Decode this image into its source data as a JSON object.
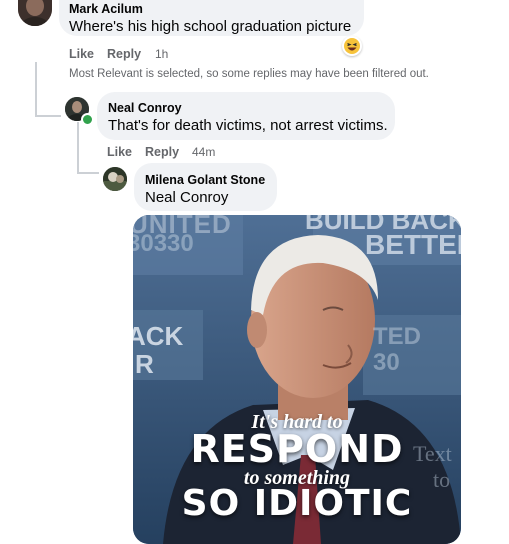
{
  "comments": [
    {
      "author": "Mark Acilum",
      "text": "Where's his high school graduation picture",
      "reaction_icon": "haha-emoji-icon",
      "like_label": "Like",
      "reply_label": "Reply",
      "time": "1h"
    },
    {
      "author": "Neal Conroy",
      "text": "That's for death victims, not arrest victims.",
      "online_status_color": "#31a24c",
      "like_label": "Like",
      "reply_label": "Reply",
      "time": "44m"
    },
    {
      "author": "Milena Golant Stone",
      "mention": "Neal Conroy"
    }
  ],
  "filter_notice": "Most Relevant is selected, so some replies may have been filtered out.",
  "gif": {
    "line1": "It's hard to",
    "line2": "RESPOND",
    "line3": "to something",
    "line4": "SO IDIOTIC",
    "background_sign_1": "UNITED",
    "background_sign_2": "30330",
    "background_sign_3": "BUILD BACK",
    "background_sign_4": "BETTER",
    "background_sign_5": "ACK",
    "background_sign_6": "R",
    "background_sign_7": "TED",
    "background_sign_8": "30",
    "background_sign_9": "Text",
    "background_sign_10": "to"
  },
  "colors": {
    "bubble": "#f0f2f5",
    "secondary_text": "#65676b",
    "gif_background": "#2f4f78"
  }
}
